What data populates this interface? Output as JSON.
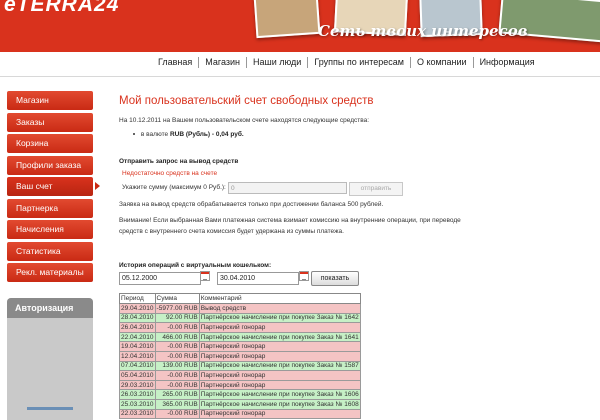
{
  "header": {
    "logo": "eTERRA24",
    "tagline": "Сеть твоих интересов"
  },
  "topnav": [
    "Главная",
    "Магазин",
    "Наши люди",
    "Группы по интересам",
    "О компании",
    "Информация"
  ],
  "sidebar": {
    "items": [
      "Магазин",
      "Заказы",
      "Корзина",
      "Профили заказа",
      "Ваш счет",
      "Партнерка",
      "Начисления",
      "Статистика",
      "Рекл. материалы"
    ],
    "active_index": 4
  },
  "auth": {
    "title": "Авторизация"
  },
  "main": {
    "title": "Мой пользовательский счет свободных средств",
    "balance_intro": "На 10.12.2011 на Вашем пользовательском счете находятся следующие средства:",
    "balance_prefix": "в валюте",
    "balance_value": "RUB (Рубль) - 0,04 руб.",
    "withdraw_title": "Отправить запрос на вывод средств",
    "withdraw_error": "Недостаточно средств на счете",
    "amount_label": "Укажите сумму (максимум 0 Руб.):",
    "amount_value": "0",
    "submit_label": "отправить",
    "note1": "Заявка на вывод средств обрабатывается только при достижении баланса 500 рублей.",
    "note2_line1": "Внимание! Если выбранная Вами платежная система взимает комиссию на внутренние операции, при переводе",
    "note2_line2": "средств с внутреннего счета комиссия будет удержана из суммы платежа.",
    "history_title": "История операций с виртуальным кошельком:",
    "date_from": "05.12.2000",
    "date_to": "30.04.2010",
    "show_label": "показать",
    "table": {
      "headers": [
        "Период",
        "Сумма",
        "Комментарий"
      ],
      "rows": [
        {
          "date": "29.04.2010",
          "amount": "-5977.00 RUB",
          "comment": "Вывод средств",
          "type": "neg"
        },
        {
          "date": "28.04.2010",
          "amount": "92.00 RUB",
          "comment": "Партнёрское начисление при покупке Заказ № 1642",
          "type": "pos"
        },
        {
          "date": "26.04.2010",
          "amount": "-0.00 RUB",
          "comment": "Партнерский гонорар",
          "type": "neg"
        },
        {
          "date": "22.04.2010",
          "amount": "466.00 RUB",
          "comment": "Партнёрское начисление при покупке Заказ № 1641",
          "type": "pos"
        },
        {
          "date": "19.04.2010",
          "amount": "-0.00 RUB",
          "comment": "Партнерский гонорар",
          "type": "neg"
        },
        {
          "date": "12.04.2010",
          "amount": "-0.00 RUB",
          "comment": "Партнерский гонорар",
          "type": "neg"
        },
        {
          "date": "07.04.2010",
          "amount": "139.00 RUB",
          "comment": "Партнёрское начисление при покупке Заказ № 1587",
          "type": "pos"
        },
        {
          "date": "05.04.2010",
          "amount": "-0.00 RUB",
          "comment": "Партнерский гонорар",
          "type": "neg"
        },
        {
          "date": "29.03.2010",
          "amount": "-0.00 RUB",
          "comment": "Партнерский гонорар",
          "type": "neg"
        },
        {
          "date": "26.03.2010",
          "amount": "265.00 RUB",
          "comment": "Партнёрское начисление при покупке Заказ № 1606",
          "type": "pos"
        },
        {
          "date": "25.03.2010",
          "amount": "365.00 RUB",
          "comment": "Партнёрское начисление при покупке Заказ № 1608",
          "type": "pos"
        },
        {
          "date": "22.03.2010",
          "amount": "-0.00 RUB",
          "comment": "Партнерский гонорар",
          "type": "neg"
        }
      ]
    }
  }
}
